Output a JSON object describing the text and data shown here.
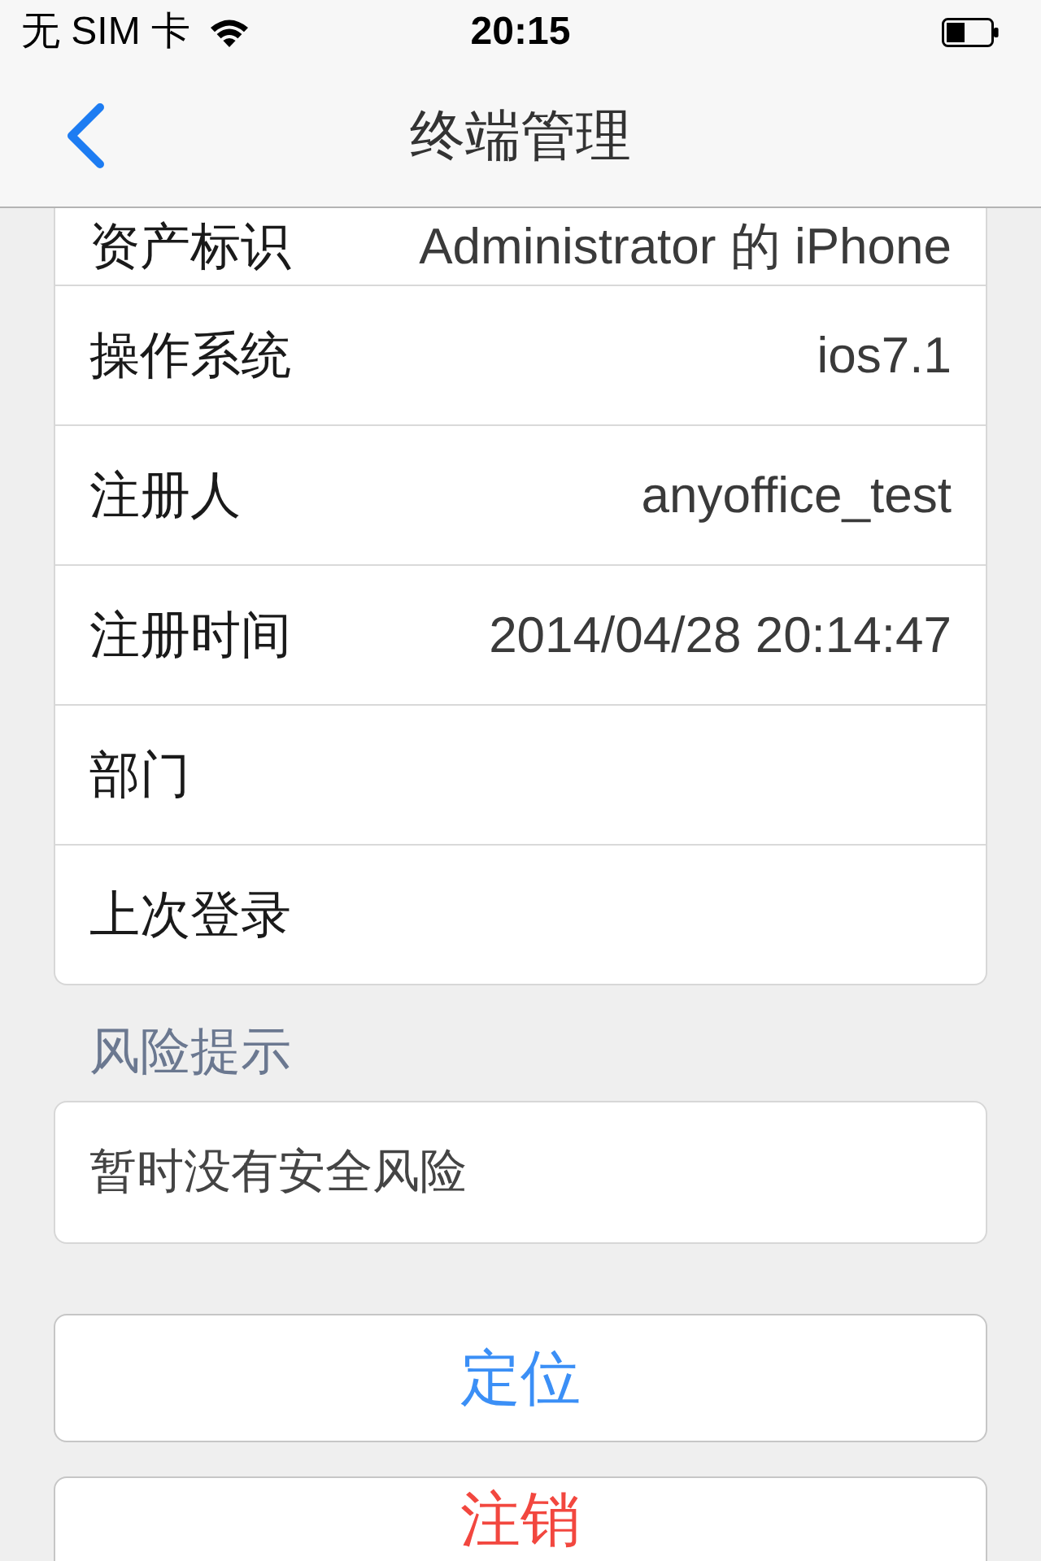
{
  "status_bar": {
    "carrier": "无 SIM 卡",
    "time": "20:15"
  },
  "nav_bar": {
    "title": "终端管理"
  },
  "device_info": {
    "rows": [
      {
        "label": "资产标识",
        "value": "Administrator 的 iPhone"
      },
      {
        "label": "操作系统",
        "value": "ios7.1"
      },
      {
        "label": "注册人",
        "value": "anyoffice_test"
      },
      {
        "label": "注册时间",
        "value": "2014/04/28 20:14:47"
      },
      {
        "label": "部门"
      },
      {
        "label": "上次登录"
      }
    ]
  },
  "risk_section": {
    "title": "风险提示",
    "message": "暂时没有安全风险"
  },
  "buttons": [
    {
      "label": "定位",
      "kind": "primary"
    },
    {
      "label": "注销",
      "kind": "destructive"
    }
  ]
}
